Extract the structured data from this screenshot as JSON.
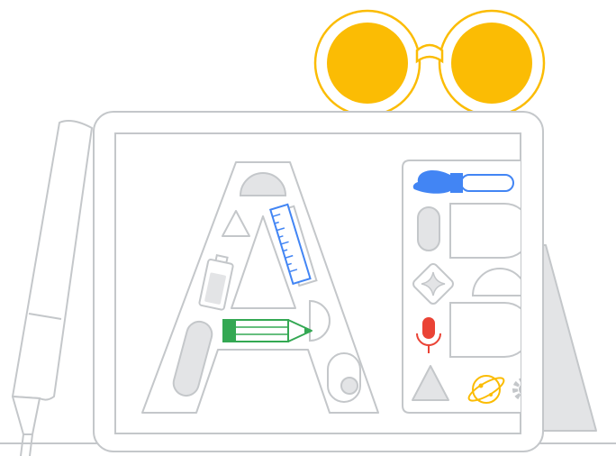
{
  "colors": {
    "outline": "#c4c7ca",
    "panel_fill": "#ffffff",
    "soft_gray": "#e3e4e6",
    "ground_gray": "#dadce0",
    "blue": "#4285f4",
    "green": "#34a853",
    "red": "#ea4335",
    "yellow": "#fbbc04"
  },
  "icons": [
    "eyeglasses-icon",
    "tablet",
    "stylus-pen",
    "letter-a-shape",
    "paintbrush-icon",
    "ruler-icon",
    "battery-icon",
    "pencil-icon",
    "microphone-icon",
    "planet-icon",
    "gear-icon",
    "sparkle-diamond-icon",
    "triangle-shape"
  ]
}
